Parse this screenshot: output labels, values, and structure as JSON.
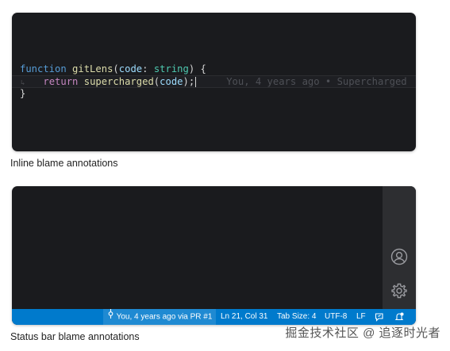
{
  "inline_panel": {
    "code": {
      "line1": {
        "keyword": "function",
        "name": "gitLens",
        "open": "(",
        "param": "code",
        "colon": ": ",
        "type": "string",
        "close": ") {"
      },
      "line2": {
        "keyword": "return",
        "call": "supercharged",
        "open": "(",
        "arg": "code",
        "close": ");",
        "blame": "You, 4 years ago • Supercharged"
      },
      "line3": "}"
    },
    "caption": "Inline blame annotations"
  },
  "statusbar_panel": {
    "activity_icons": [
      "account-icon",
      "settings-gear-icon"
    ],
    "status_bar": {
      "blame": "You, 4 years ago via PR #1",
      "cursor_position": "Ln 21, Col 31",
      "tab_size": "Tab Size: 4",
      "encoding": "UTF-8",
      "line_ending": "LF",
      "accent_color": "#007acc"
    },
    "caption": "Status bar blame annotations"
  },
  "watermark": "掘金技术社区 @ 追逐时光者"
}
